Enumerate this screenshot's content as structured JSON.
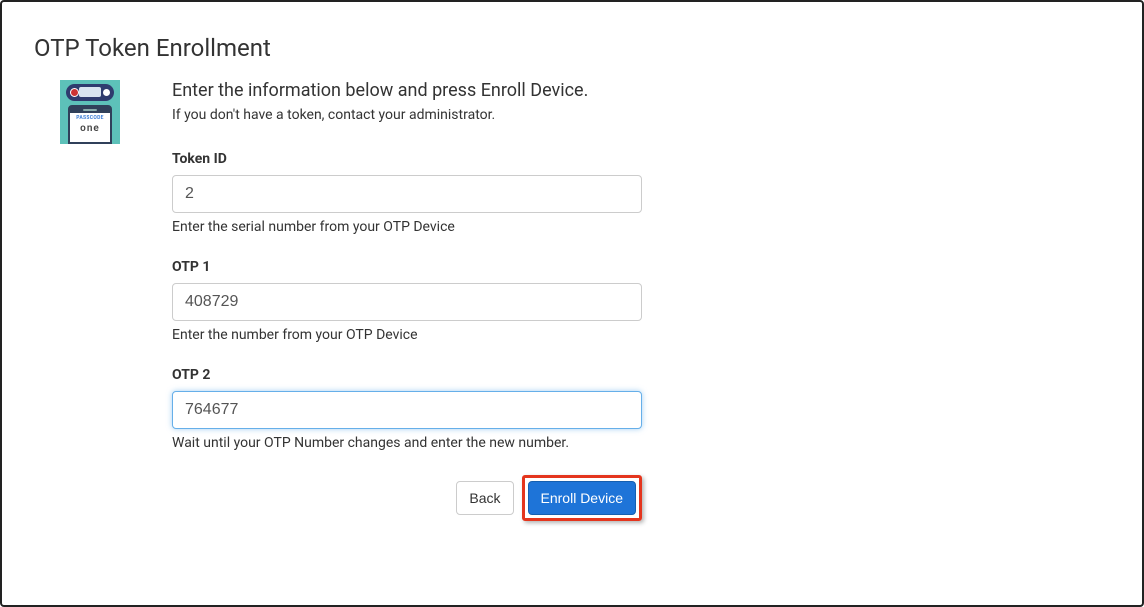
{
  "page": {
    "title": "OTP Token Enrollment"
  },
  "intro": {
    "heading": "Enter the information below and press Enroll Device.",
    "sub": "If you don't have a token, contact your administrator."
  },
  "illustration": {
    "phone_header": "PASSCODE",
    "phone_body": "one"
  },
  "fields": {
    "token_id": {
      "label": "Token ID",
      "value": "2",
      "hint": "Enter the serial number from your OTP Device"
    },
    "otp1": {
      "label": "OTP 1",
      "value": "408729",
      "hint": "Enter the number from your OTP Device"
    },
    "otp2": {
      "label": "OTP 2",
      "value": "764677",
      "hint": "Wait until your OTP Number changes and enter the new number."
    }
  },
  "buttons": {
    "back": "Back",
    "enroll": "Enroll Device"
  },
  "highlight": {
    "target": "enroll-device-button",
    "color": "#e4351d"
  }
}
